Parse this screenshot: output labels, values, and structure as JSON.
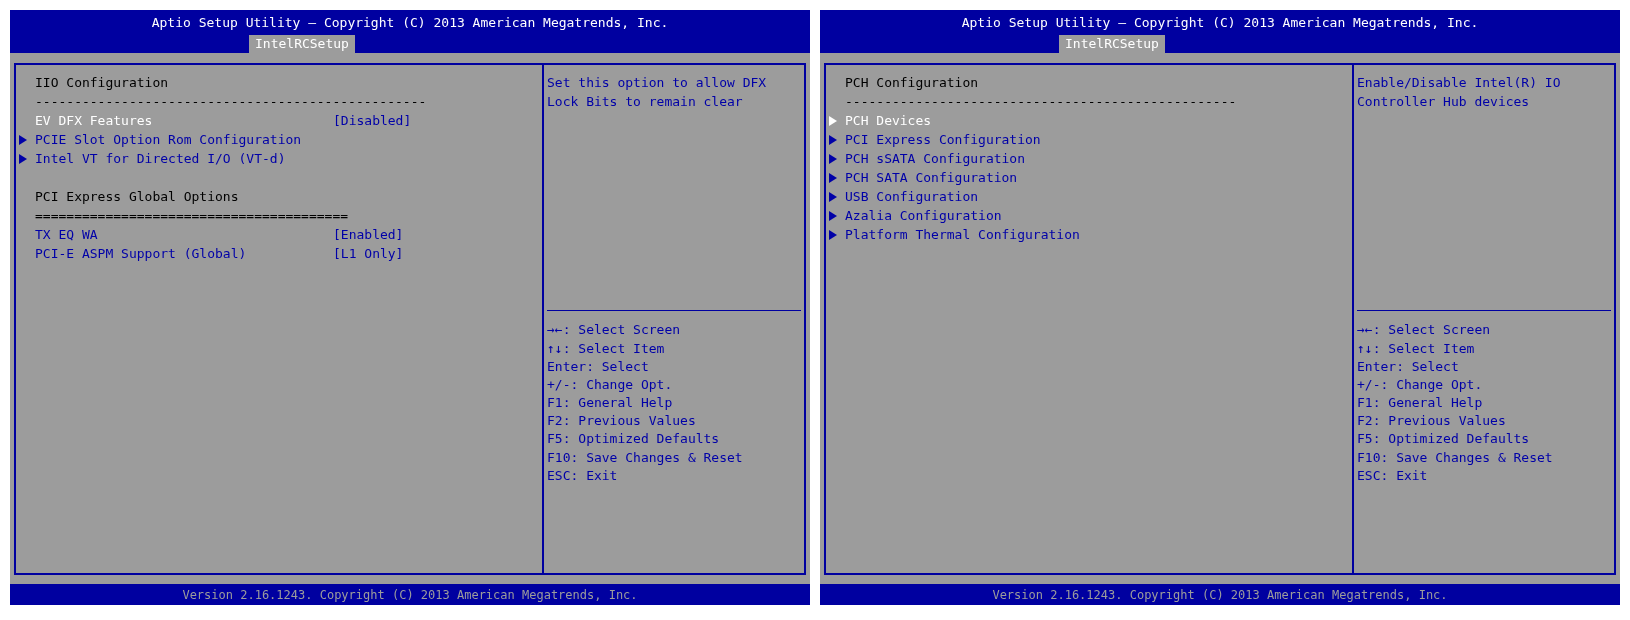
{
  "screens": [
    {
      "title": "Aptio Setup Utility – Copyright (C) 2013 American Megatrends, Inc.",
      "tabs": [
        {
          "label": "IntelRCSetup",
          "selected": true
        }
      ],
      "items": [
        {
          "kind": "heading",
          "label": "IIO Configuration"
        },
        {
          "kind": "separator",
          "label": "--------------------------------------------------"
        },
        {
          "kind": "setting",
          "label": "EV DFX Features",
          "value": "[Disabled]",
          "selected": true
        },
        {
          "kind": "submenu",
          "label": "PCIE Slot Option Rom Configuration",
          "selected": false
        },
        {
          "kind": "submenu",
          "label": "Intel VT for Directed I/O (VT-d)",
          "selected": false
        },
        {
          "kind": "blank"
        },
        {
          "kind": "heading",
          "label": "PCI Express Global Options"
        },
        {
          "kind": "separator",
          "label": "========================================"
        },
        {
          "kind": "setting",
          "label": "TX EQ WA",
          "value": "[Enabled]",
          "selected": false
        },
        {
          "kind": "setting",
          "label": "PCI-E ASPM Support (Global)",
          "value": "[L1 Only]",
          "selected": false
        }
      ],
      "help": "Set this option to allow DFX Lock Bits to remain clear",
      "keys": [
        "→←: Select Screen",
        "↑↓: Select Item",
        "Enter: Select",
        "+/-: Change Opt.",
        "F1: General Help",
        "F2: Previous Values",
        "F5: Optimized Defaults",
        "F10: Save Changes & Reset",
        "ESC: Exit"
      ],
      "footer": "Version 2.16.1243. Copyright (C) 2013 American Megatrends, Inc."
    },
    {
      "title": "Aptio Setup Utility – Copyright (C) 2013 American Megatrends, Inc.",
      "tabs": [
        {
          "label": "IntelRCSetup",
          "selected": true
        }
      ],
      "items": [
        {
          "kind": "heading",
          "label": "PCH Configuration"
        },
        {
          "kind": "separator",
          "label": "--------------------------------------------------"
        },
        {
          "kind": "submenu",
          "label": "PCH Devices",
          "selected": true
        },
        {
          "kind": "submenu",
          "label": "PCI Express Configuration",
          "selected": false
        },
        {
          "kind": "submenu",
          "label": "PCH sSATA Configuration",
          "selected": false
        },
        {
          "kind": "submenu",
          "label": "PCH SATA Configuration",
          "selected": false
        },
        {
          "kind": "submenu",
          "label": "USB Configuration",
          "selected": false
        },
        {
          "kind": "submenu",
          "label": "Azalia Configuration",
          "selected": false
        },
        {
          "kind": "submenu",
          "label": "Platform Thermal Configuration",
          "selected": false
        }
      ],
      "help": "Enable/Disable Intel(R) IO Controller Hub devices",
      "keys": [
        "→←: Select Screen",
        "↑↓: Select Item",
        "Enter: Select",
        "+/-: Change Opt.",
        "F1: General Help",
        "F2: Previous Values",
        "F5: Optimized Defaults",
        "F10: Save Changes & Reset",
        "ESC: Exit"
      ],
      "footer": "Version 2.16.1243. Copyright (C) 2013 American Megatrends, Inc."
    }
  ]
}
